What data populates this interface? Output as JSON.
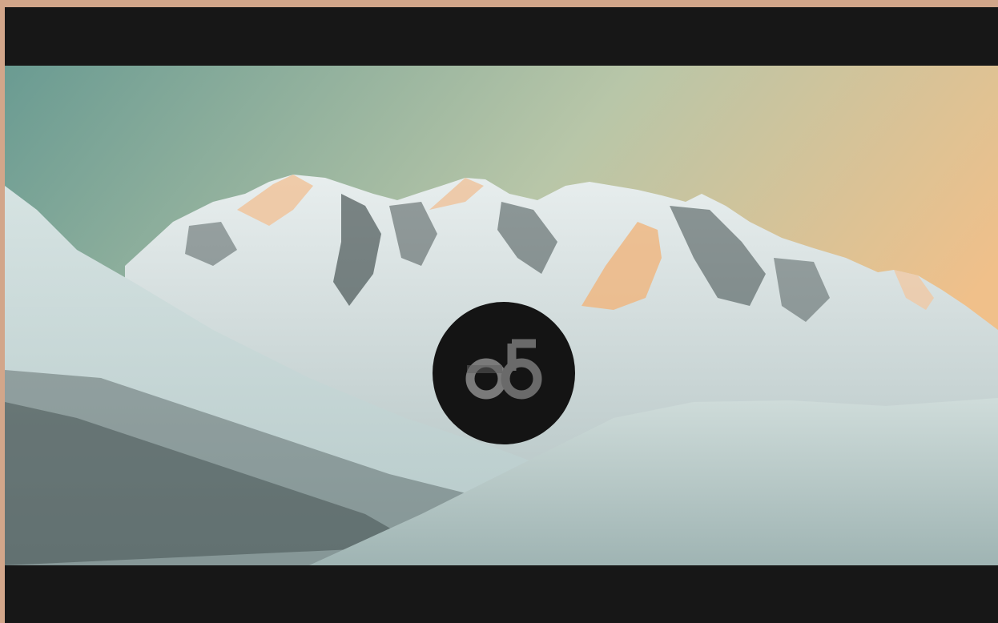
{
  "page": {
    "background_color": "#d2a68a",
    "frame_color": "#171717"
  },
  "video": {
    "scene": "snowy-mountain-range-at-sunset",
    "sky_colors": [
      "#6fa095",
      "#c9cfac",
      "#ecc08c"
    ],
    "snow_color": "#dde8e6",
    "logo_icon": "ob-logo-icon",
    "logo_background": "#141414",
    "logo_foreground": "#6f6f6f"
  }
}
